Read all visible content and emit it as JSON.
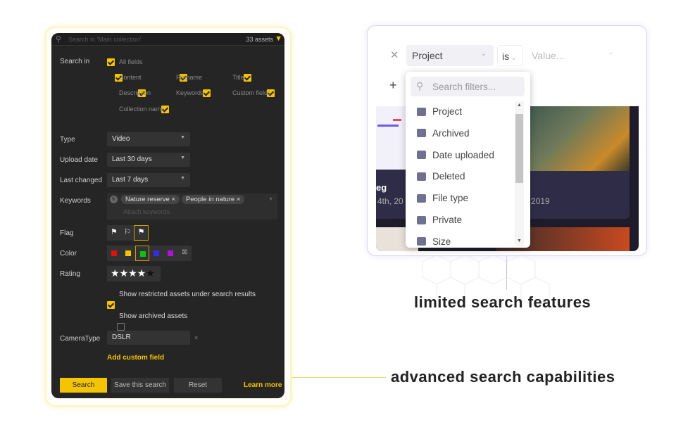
{
  "advanced": {
    "search_placeholder": "Search in 'Main collection'",
    "asset_count": "33 assets",
    "search_in_label": "Search in",
    "search_in_options": [
      {
        "label": "All fields",
        "checked": true
      },
      {
        "label": "Content",
        "checked": true
      },
      {
        "label": "Filename",
        "checked": true
      },
      {
        "label": "Title",
        "checked": true
      },
      {
        "label": "Description",
        "checked": true
      },
      {
        "label": "Keywords",
        "checked": true
      },
      {
        "label": "Custom fields",
        "checked": true
      },
      {
        "label": "Collection name",
        "checked": true
      }
    ],
    "type_label": "Type",
    "type_value": "Video",
    "upload_label": "Upload date",
    "upload_value": "Last 30 days",
    "changed_label": "Last changed",
    "changed_value": "Last 7 days",
    "keywords_label": "Keywords",
    "keywords": [
      "Nature reserve",
      "People in nature"
    ],
    "keywords_placeholder": "Attach keywords",
    "flag_label": "Flag",
    "color_label": "Color",
    "colors": [
      "#e01010",
      "#f5c400",
      "#12c012",
      "#3a2ae8",
      "#b012e0"
    ],
    "selected_color": "#12c012",
    "rating_label": "Rating",
    "rating": 4,
    "rating_max": 5,
    "restricted_label": "Show restricted assets under search results",
    "restricted_checked": true,
    "archived_label": "Show archived assets",
    "archived_checked": false,
    "camera_label": "CameraType",
    "camera_value": "DSLR",
    "add_custom": "Add custom field",
    "search_btn": "Search",
    "save_btn": "Save this search",
    "reset_btn": "Reset",
    "learn_more": "Learn more",
    "accent": "#f5c400"
  },
  "limited": {
    "field_value": "Project",
    "operator": "is",
    "value_placeholder": "Value...",
    "filter_search_placeholder": "Search filters...",
    "filters": [
      {
        "label": "Project",
        "icon": "box-icon"
      },
      {
        "label": "Archived",
        "icon": "archive-icon"
      },
      {
        "label": "Date uploaded",
        "icon": "tag-icon"
      },
      {
        "label": "Deleted",
        "icon": "trash-icon"
      },
      {
        "label": "File type",
        "icon": "file-type-icon"
      },
      {
        "label": "Private",
        "icon": "lock-icon"
      },
      {
        "label": "Size",
        "icon": "size-icon"
      }
    ],
    "card_title_partial": "eg",
    "card_date_left": "4th, 20",
    "card_date_right": "n 27th, 2019"
  },
  "captions": {
    "limited": "limited search features",
    "advanced": "advanced search capabilities"
  }
}
